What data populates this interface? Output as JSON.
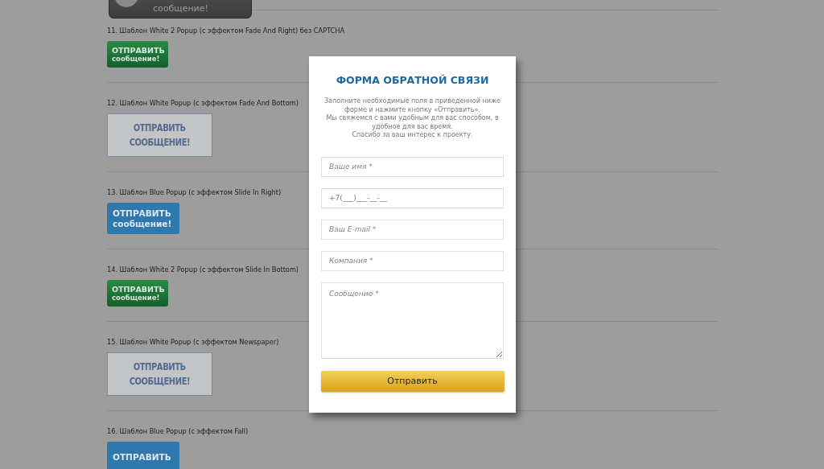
{
  "top_button": {
    "kind": "dark",
    "lines": [
      "сообщение!"
    ]
  },
  "templates": [
    {
      "label": "11. Шаблон White 2 Popup (с эффектом Fade And Right) без CAPTCHA",
      "button": {
        "kind": "green",
        "lines": [
          "ОТПРАВИТЬ",
          "сообщение!"
        ]
      }
    },
    {
      "label": "12. Шаблон White Popup (с эффектом Fade And Bottom)",
      "button": {
        "kind": "white",
        "lines": [
          "ОТПРАВИТЬ",
          "СООБЩЕНИЕ!"
        ]
      }
    },
    {
      "label": "13. Шаблон Blue Popup (с эффектом Slide In Right)",
      "button": {
        "kind": "blue",
        "lines": [
          "ОТПРАВИТЬ",
          "сообщение!"
        ]
      }
    },
    {
      "label": "14. Шаблон White 2 Popup (с эффектом Slide In Bottom)",
      "button": {
        "kind": "green",
        "lines": [
          "ОТПРАВИТЬ",
          "сообщение!"
        ]
      }
    },
    {
      "label": "15. Шаблон White Popup (с эффектом Newspaper)",
      "button": {
        "kind": "white",
        "lines": [
          "ОТПРАВИТЬ",
          "СООБЩЕНИЕ!"
        ]
      }
    },
    {
      "label": "16. Шаблон Blue Popup (с эффектом Fall)",
      "button": {
        "kind": "blue",
        "lines": [
          "ОТПРАВИТЬ"
        ]
      }
    }
  ],
  "popup": {
    "title": "ФОРМА ОБРАТНОЙ СВЯЗИ",
    "description": [
      "Заполните необходимые поля в приведенной ниже форме и нажмите кнопку «Отправить».",
      "Мы свяжемся с вами удобным для вас способом, в удобное для вас время.",
      "Спасибо за ваш интерес к проекту."
    ],
    "fields": [
      {
        "kind": "input",
        "placeholder": "Ваше имя *"
      },
      {
        "kind": "input",
        "value": "+7(___)___-__-__"
      },
      {
        "kind": "input",
        "placeholder": "Ваш E-mail *"
      },
      {
        "kind": "input",
        "placeholder": "Компания *"
      },
      {
        "kind": "textarea",
        "placeholder": "Сообщение *"
      }
    ],
    "submit": "Отправить"
  }
}
